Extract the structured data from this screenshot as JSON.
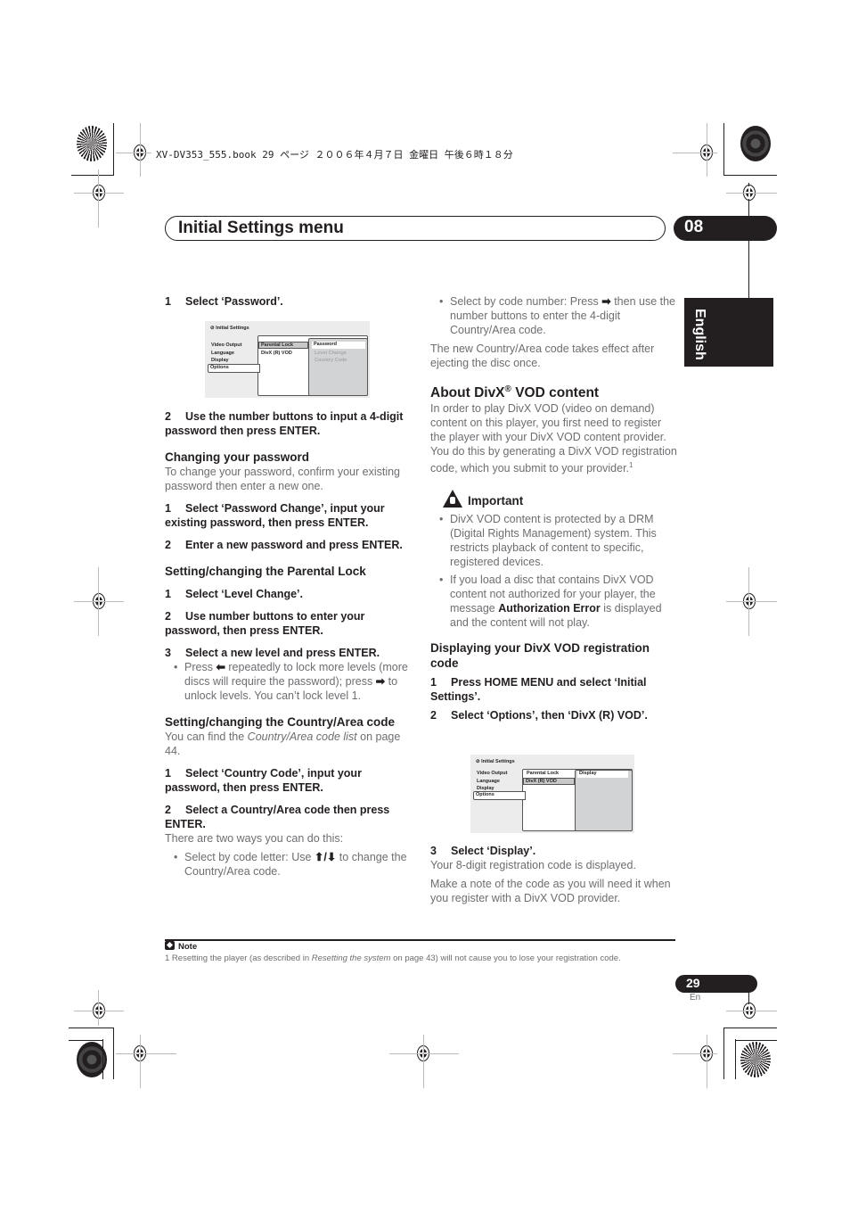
{
  "print_header": "XV-DV353_555.book  29 ページ  ２００６年４月７日  金曜日  午後６時１８分",
  "header": {
    "title": "Initial Settings menu",
    "chapter": "08",
    "language_tab": "English"
  },
  "left_column": {
    "step_select_password": {
      "num": "1",
      "text": "Select ‘Password’."
    },
    "screen1": {
      "title": "Initial Settings",
      "left_menu": [
        "Video Output",
        "Language",
        "Display",
        "Options"
      ],
      "mid_menu": [
        "Parental Lock",
        "DivX (R) VOD"
      ],
      "right_menu": [
        "Password",
        "Level Change",
        "Country Code"
      ]
    },
    "step_input_password": {
      "num": "2",
      "text": "Use the number buttons to input a 4-digit password then press ENTER."
    },
    "changing_password": {
      "heading": "Changing your password",
      "body": "To change your password, confirm your existing password then enter a new one.",
      "steps": [
        {
          "num": "1",
          "text": "Select ‘Password Change’, input your existing password, then press ENTER."
        },
        {
          "num": "2",
          "text": "Enter a new password and press ENTER."
        }
      ]
    },
    "parental_lock": {
      "heading": "Setting/changing the Parental Lock",
      "steps": [
        {
          "num": "1",
          "text": "Select ‘Level Change’."
        },
        {
          "num": "2",
          "text": "Use number buttons to enter your password, then press ENTER."
        },
        {
          "num": "3",
          "text": "Select a new level and press ENTER."
        }
      ],
      "bullet_parts": [
        "Press ",
        "⬅",
        " repeatedly to lock more levels (more discs will require the password); press ",
        "➡",
        " to unlock levels. You can’t lock level 1."
      ]
    },
    "country_code": {
      "heading": "Setting/changing the Country/Area code",
      "body_pre": "You can find the ",
      "body_italic": "Country/Area code list",
      "body_post": " on page 44.",
      "steps": [
        {
          "num": "1",
          "text": "Select ‘Country Code’, input your password, then press ENTER."
        },
        {
          "num": "2",
          "text": "Select a Country/Area code then press ENTER."
        }
      ],
      "two_ways": "There are two ways you can do this:",
      "bullet_letter_parts": [
        "Select by code letter: Use ",
        "⬆/⬇",
        " to change the Country/Area code."
      ]
    }
  },
  "right_column": {
    "bullet_number_parts": [
      "Select by code number: Press ",
      "➡",
      " then use the number buttons to enter the 4-digit Country/Area code."
    ],
    "takes_effect": "The new Country/Area code takes effect after ejecting the disc once.",
    "divx": {
      "heading_pre": "About DivX",
      "heading_sup": "®",
      "heading_post": " VOD content",
      "body": "In order to play DivX VOD (video on demand) content on this player, you first need to register the player with your DivX VOD content provider. You do this by generating a DivX VOD registration code, which you submit to your provider.",
      "footnote_ref": "1"
    },
    "important": {
      "label": "Important",
      "bullet1": "DivX VOD content is protected by a DRM (Digital Rights Management) system. This restricts playback of content to specific, registered devices.",
      "bullet2_pre": "If you load a disc that contains DivX VOD content not authorized for your player, the message ",
      "bullet2_bold": "Authorization Error",
      "bullet2_post": " is displayed and the content will not play."
    },
    "display_code": {
      "heading": "Displaying your DivX VOD registration code",
      "steps": [
        {
          "num": "1",
          "text": "Press HOME MENU and select ‘Initial Settings’."
        },
        {
          "num": "2",
          "text": "Select ‘Options’, then ‘DivX (R) VOD’."
        }
      ]
    },
    "screen2": {
      "title": "Initial Settings",
      "left_menu": [
        "Video Output",
        "Language",
        "Display",
        "Options"
      ],
      "mid_menu": [
        "Parental Lock",
        "DivX (R) VOD"
      ],
      "right_menu": [
        "Display"
      ]
    },
    "step_select_display": {
      "num": "3",
      "text": "Select ‘Display’."
    },
    "code_displayed": "Your 8-digit registration code is displayed.",
    "make_note": "Make a note of the code as you will need it when you register with a DivX VOD provider."
  },
  "footer": {
    "note_label": "Note",
    "footnote_pre": "1 Resetting the player (as described in ",
    "footnote_italic": "Resetting the system",
    "footnote_post": " on page 43) will not cause you to lose your registration code.",
    "page_number": "29",
    "page_lang": "En"
  }
}
